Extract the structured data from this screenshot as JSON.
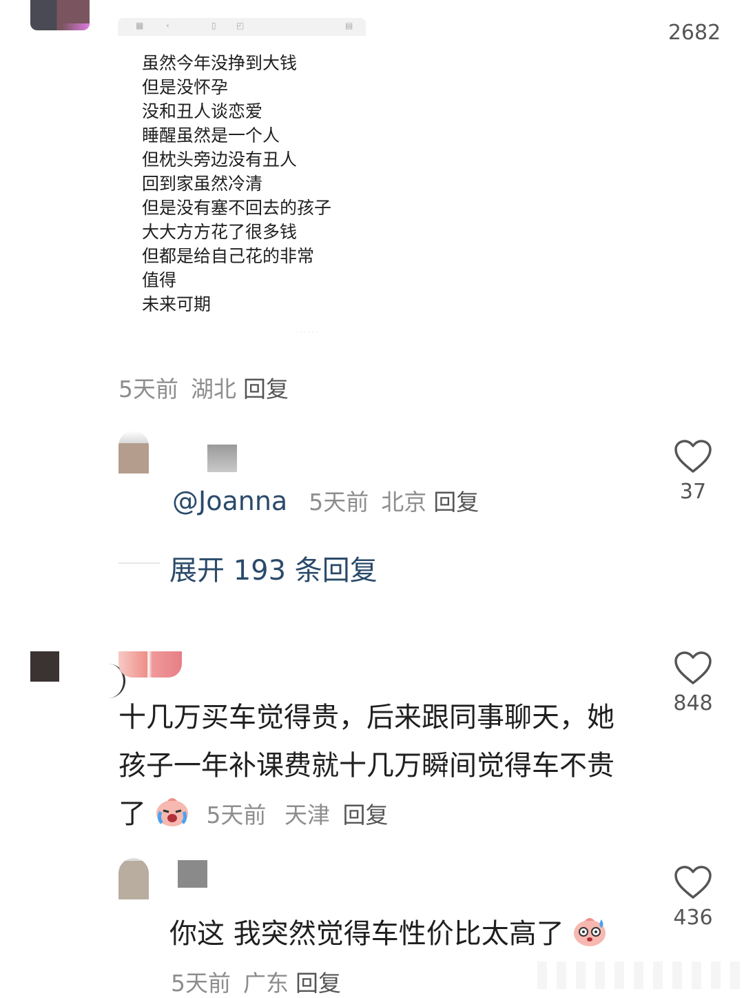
{
  "top_comment": {
    "image_lines": [
      "虽然今年没挣到大钱",
      "但是没怀孕",
      "没和丑人谈恋爱",
      "睡醒虽然是一个人",
      "但枕头旁边没有丑人",
      "回到家虽然冷清",
      "但是没有塞不回去的孩子",
      "大大方方花了很多钱",
      "但都是给自己花的非常",
      "值得",
      "未来可期"
    ],
    "time": "5天前",
    "location": "湖北",
    "reply_label": "回复",
    "likes": "2682"
  },
  "reply_1": {
    "mention": "@Joanna",
    "time": "5天前",
    "location": "北京",
    "reply_label": "回复",
    "likes": "37"
  },
  "expand_replies": {
    "label": "展开 193 条回复"
  },
  "comment_2": {
    "text": "十几万买车觉得贵，后来跟同事聊天，她孩子一年补课费就十几万瞬间觉得车不贵了",
    "emoji": "crying-laugh-emoji",
    "time": "5天前",
    "location": "天津",
    "reply_label": "回复",
    "likes": "848"
  },
  "reply_2": {
    "text": "你这 我突然觉得车性价比太高了",
    "emoji": "sweating-shocked-emoji",
    "time": "5天前",
    "location": "广东",
    "reply_label": "回复",
    "likes": "436"
  },
  "colors": {
    "link": "#2a4a6a",
    "meta": "#8d8d8d",
    "text": "#1f1f1f"
  }
}
